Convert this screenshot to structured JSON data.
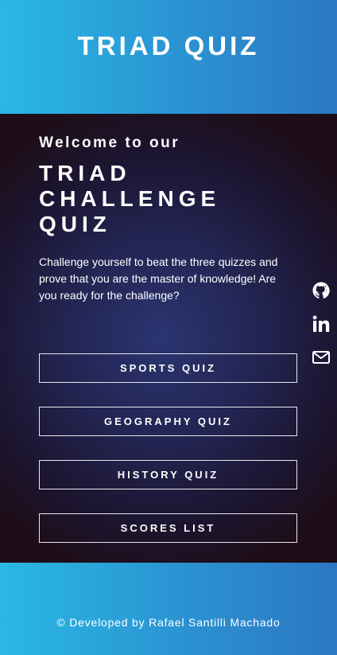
{
  "header": {
    "title": "TRIAD QUIZ"
  },
  "main": {
    "welcome": "Welcome to our",
    "title_lines": [
      "TRIAD",
      "CHALLENGE",
      "QUIZ"
    ],
    "description": "Challenge yourself to beat the three quizzes and prove that you are the master of knowledge! Are you ready for the challenge?",
    "buttons": [
      "SPORTS QUIZ",
      "GEOGRAPHY QUIZ",
      "HISTORY QUIZ",
      "SCORES LIST"
    ]
  },
  "social": [
    "github-icon",
    "linkedin-icon",
    "mail-icon"
  ],
  "footer": {
    "text": "© Developed by Rafael Santilli Machado"
  }
}
